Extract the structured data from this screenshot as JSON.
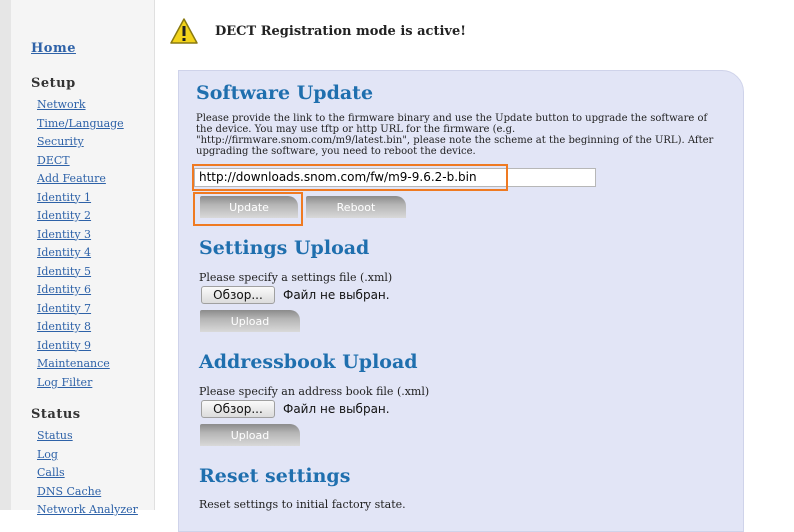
{
  "sidebar": {
    "home_label": "Home",
    "setup_title": "Setup",
    "setup_items": [
      "Network",
      "Time/Language",
      "Security",
      "DECT",
      "Add Feature",
      "Identity 1",
      "Identity 2",
      "Identity 3",
      "Identity 4",
      "Identity 5",
      "Identity 6",
      "Identity 7",
      "Identity 8",
      "Identity 9",
      "Maintenance",
      "Log Filter"
    ],
    "status_title": "Status",
    "status_items": [
      "Status",
      "Log",
      "Calls",
      "DNS Cache",
      "Network Analyzer"
    ]
  },
  "alert": {
    "text": "DECT Registration mode is active!",
    "icon": "warning-icon",
    "color": "#f2d31b"
  },
  "software_update": {
    "title": "Software Update",
    "description": "Please provide the link to the firmware binary and use the Update button to upgrade the software of the device. You may use tftp or http URL for the firmware (e.g. \"http://firmware.snom.com/m9/latest.bin\", please note the scheme at the beginning of the URL). After upgrading the software, you need to reboot the device.",
    "url_value": "http://downloads.snom.com/fw/m9-9.6.2-b.bin",
    "update_label": "Update",
    "reboot_label": "Reboot"
  },
  "settings_upload": {
    "title": "Settings Upload",
    "prompt": "Please specify a settings file (.xml)",
    "browse_label": "Обзор...",
    "file_status": "Файл не выбран.",
    "upload_label": "Upload"
  },
  "addressbook_upload": {
    "title": "Addressbook Upload",
    "prompt": "Please specify an address book file (.xml)",
    "browse_label": "Обзор...",
    "file_status": "Файл не выбран.",
    "upload_label": "Upload"
  },
  "reset": {
    "title": "Reset settings",
    "prompt": "Reset settings to initial factory state."
  },
  "colors": {
    "accent": "#1f6fae",
    "link": "#2e62a8",
    "panel": "#e2e5f6",
    "highlight": "#ef7a22"
  }
}
